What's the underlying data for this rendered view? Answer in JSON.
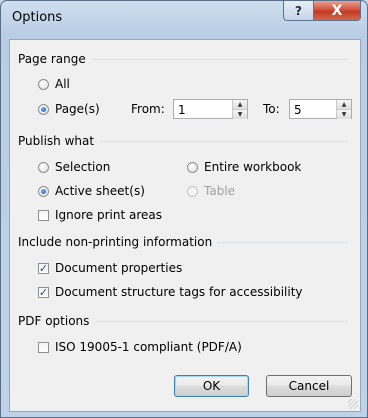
{
  "window": {
    "title": "Options",
    "help_glyph": "?",
    "close_glyph": "X"
  },
  "page_range": {
    "heading": "Page range",
    "all_label": "All",
    "pages_label": "Page(s)",
    "from_label": "From:",
    "from_value": "1",
    "to_label": "To:",
    "to_value": "5",
    "selected": "pages"
  },
  "publish_what": {
    "heading": "Publish what",
    "selection_label": "Selection",
    "entire_workbook_label": "Entire workbook",
    "active_sheets_label": "Active sheet(s)",
    "table_label": "Table",
    "ignore_print_areas_label": "Ignore print areas",
    "selected": "active_sheets",
    "ignore_print_areas_checked": false
  },
  "non_printing": {
    "heading": "Include non-printing information",
    "doc_props_label": "Document properties",
    "doc_props_checked": true,
    "doc_struct_label": "Document structure tags for accessibility",
    "doc_struct_checked": true
  },
  "pdf_options": {
    "heading": "PDF options",
    "iso_label": "ISO 19005-1 compliant (PDF/A)",
    "iso_checked": false
  },
  "buttons": {
    "ok_label": "OK",
    "cancel_label": "Cancel"
  },
  "icons": {
    "check_glyph": "✓",
    "spin_up": "▲",
    "spin_down": "▼"
  },
  "colors": {
    "title_bar": "#bfd2e7",
    "close_button": "#c8452f",
    "dialog_body": "#f0f0f0",
    "default_button_border": "#3c7fb1"
  }
}
